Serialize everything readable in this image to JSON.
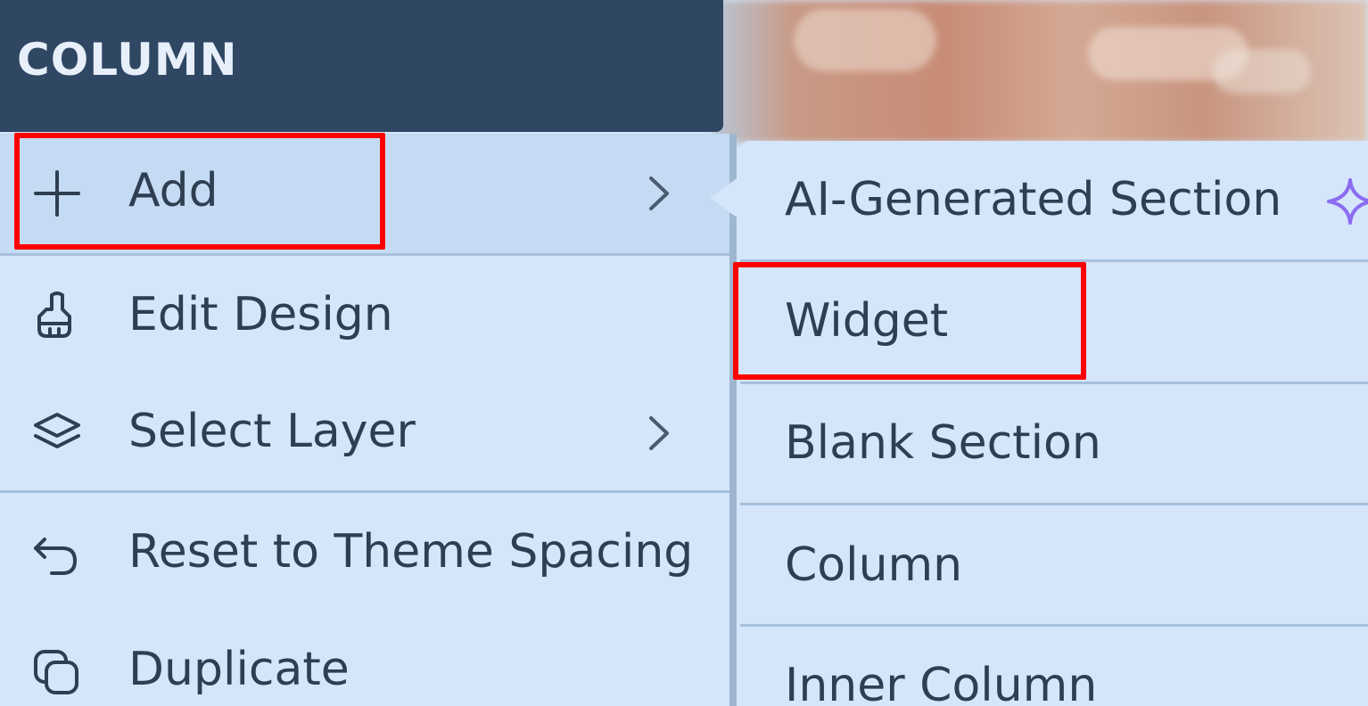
{
  "header": {
    "title": "COLUMN"
  },
  "menu": {
    "items": [
      {
        "label": "Add",
        "icon": "plus-icon",
        "has_submenu": true
      },
      {
        "label": "Edit Design",
        "icon": "brush-icon",
        "has_submenu": false
      },
      {
        "label": "Select Layer",
        "icon": "layers-icon",
        "has_submenu": true
      },
      {
        "label": "Reset to Theme Spacing",
        "icon": "undo-icon",
        "has_submenu": false
      },
      {
        "label": "Duplicate",
        "icon": "duplicate-icon",
        "has_submenu": false
      }
    ]
  },
  "submenu": {
    "items": [
      {
        "label": "AI-Generated Section",
        "icon": "sparkle-icon"
      },
      {
        "label": "Widget"
      },
      {
        "label": "Blank Section"
      },
      {
        "label": "Column"
      },
      {
        "label": "Inner Column"
      }
    ]
  },
  "colors": {
    "header_bg": "#2f4762",
    "menu_bg": "#d5e6fb",
    "hover_bg": "#c5dbf3",
    "text": "#2f3f52",
    "accent_sparkle": "#8b6cf0",
    "highlight": "#ff0000"
  }
}
